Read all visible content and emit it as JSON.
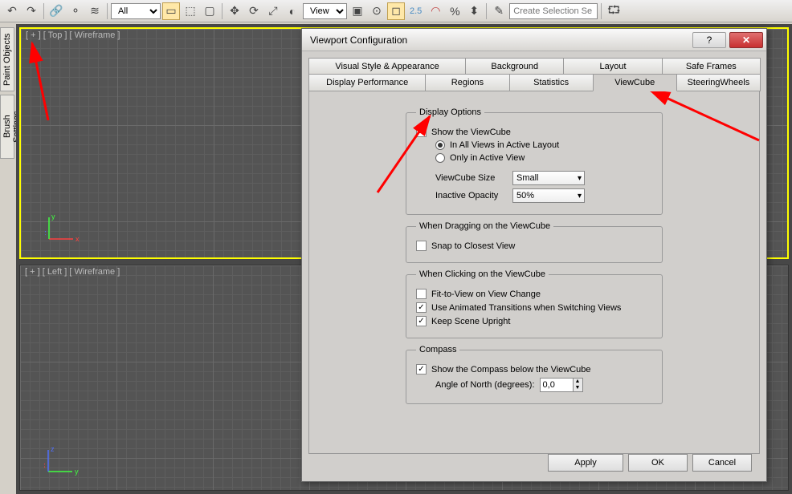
{
  "toolbar": {
    "dropdown_all": "All",
    "dropdown_view": "View",
    "value_25": "2.5",
    "create_selection": "Create Selection Se"
  },
  "sidebar": {
    "tab1": "Paint Objects",
    "tab2": "Brush Settings"
  },
  "viewports": {
    "top_label": "[ + ] [ Top ] [ Wireframe ]",
    "bottom_label": "[ + ] [ Left ] [ Wireframe ]"
  },
  "dialog": {
    "title": "Viewport Configuration",
    "tabs_row1": {
      "t1": "Visual Style & Appearance",
      "t2": "Background",
      "t3": "Layout",
      "t4": "Safe Frames"
    },
    "tabs_row2": {
      "t1": "Display Performance",
      "t2": "Regions",
      "t3": "Statistics",
      "t4": "ViewCube",
      "t5": "SteeringWheels"
    },
    "group_display": {
      "legend": "Display Options",
      "show_viewcube": "Show the ViewCube",
      "in_all_views": "In All Views in Active Layout",
      "only_active": "Only in Active View",
      "size_label": "ViewCube Size",
      "size_value": "Small",
      "opacity_label": "Inactive Opacity",
      "opacity_value": "50%"
    },
    "group_drag": {
      "legend": "When Dragging on the ViewCube",
      "snap": "Snap to Closest View"
    },
    "group_click": {
      "legend": "When Clicking on the ViewCube",
      "fit": "Fit-to-View on View Change",
      "animated": "Use Animated Transitions when Switching Views",
      "upright": "Keep Scene Upright"
    },
    "group_compass": {
      "legend": "Compass",
      "show_compass": "Show the Compass below the ViewCube",
      "angle_label": "Angle of North (degrees):",
      "angle_value": "0,0"
    },
    "buttons": {
      "apply": "Apply",
      "ok": "OK",
      "cancel": "Cancel"
    }
  }
}
